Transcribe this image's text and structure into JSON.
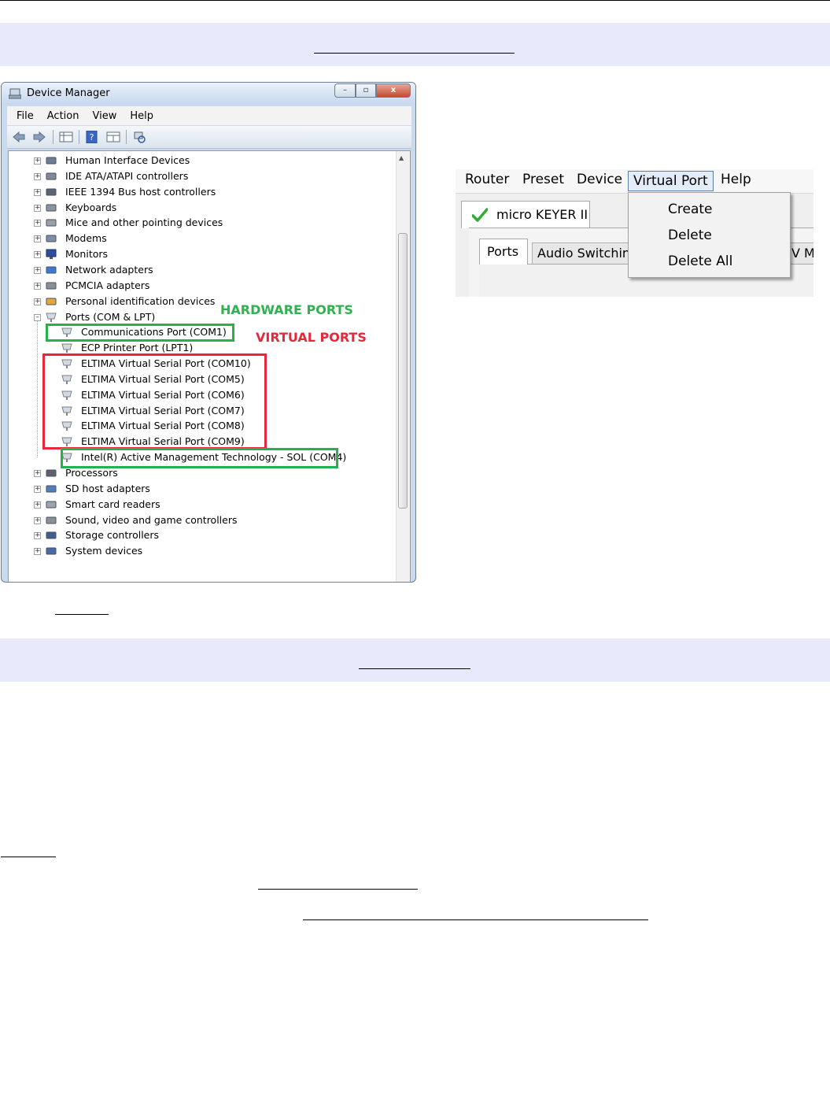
{
  "device_manager": {
    "title": "Device Manager",
    "menu": [
      "File",
      "Action",
      "View",
      "Help"
    ],
    "window_buttons": {
      "minimize": "–",
      "maximize": "▫",
      "close": "x"
    },
    "tree": [
      {
        "label": "Human Interface Devices",
        "icon": "hid-icon",
        "expander": "+"
      },
      {
        "label": "IDE ATA/ATAPI controllers",
        "icon": "ide-icon",
        "expander": "+"
      },
      {
        "label": "IEEE 1394 Bus host controllers",
        "icon": "ieee1394-icon",
        "expander": "+"
      },
      {
        "label": "Keyboards",
        "icon": "keyboard-icon",
        "expander": "+"
      },
      {
        "label": "Mice and other pointing devices",
        "icon": "mouse-icon",
        "expander": "+"
      },
      {
        "label": "Modems",
        "icon": "modem-icon",
        "expander": "+"
      },
      {
        "label": "Monitors",
        "icon": "monitor-icon",
        "expander": "+"
      },
      {
        "label": "Network adapters",
        "icon": "network-icon",
        "expander": "+"
      },
      {
        "label": "PCMCIA adapters",
        "icon": "pcmcia-icon",
        "expander": "+"
      },
      {
        "label": "Personal identification devices",
        "icon": "identification-icon",
        "expander": "+"
      },
      {
        "label": "Ports (COM & LPT)",
        "icon": "port-icon",
        "expander": "–"
      },
      {
        "label": "Communications Port (COM1)",
        "icon": "port-icon",
        "child": true
      },
      {
        "label": "ECP Printer Port (LPT1)",
        "icon": "port-icon",
        "child": true
      },
      {
        "label": "ELTIMA Virtual Serial Port (COM10)",
        "icon": "port-icon",
        "child": true
      },
      {
        "label": "ELTIMA Virtual Serial Port (COM5)",
        "icon": "port-icon",
        "child": true
      },
      {
        "label": "ELTIMA Virtual Serial Port (COM6)",
        "icon": "port-icon",
        "child": true
      },
      {
        "label": "ELTIMA Virtual Serial Port (COM7)",
        "icon": "port-icon",
        "child": true
      },
      {
        "label": "ELTIMA Virtual Serial Port (COM8)",
        "icon": "port-icon",
        "child": true
      },
      {
        "label": "ELTIMA Virtual Serial Port (COM9)",
        "icon": "port-icon",
        "child": true
      },
      {
        "label": "Intel(R) Active Management Technology - SOL (COM4)",
        "icon": "port-icon",
        "child": true
      },
      {
        "label": "Processors",
        "icon": "processor-icon",
        "expander": "+"
      },
      {
        "label": "SD host adapters",
        "icon": "sd-icon",
        "expander": "+"
      },
      {
        "label": "Smart card readers",
        "icon": "smartcard-icon",
        "expander": "+"
      },
      {
        "label": "Sound, video and game controllers",
        "icon": "speaker-icon",
        "expander": "+"
      },
      {
        "label": "Storage controllers",
        "icon": "storage-icon",
        "expander": "+"
      },
      {
        "label": "System devices",
        "icon": "system-icon",
        "expander": "+"
      }
    ],
    "annotations": {
      "hardware": "HARDWARE PORTS",
      "virtual": "VIRTUAL PORTS"
    }
  },
  "router": {
    "menu": [
      "Router",
      "Preset",
      "Device",
      "Virtual Port",
      "Help"
    ],
    "device_tab": "micro KEYER II",
    "subtabs": [
      "Ports",
      "Audio Switching",
      "V Mo"
    ],
    "dropdown": [
      "Create",
      "Delete",
      "Delete All"
    ]
  },
  "colors": {
    "section_band": "#e8e9fb",
    "hardware_box": "#28b04c",
    "virtual_box": "#e6283a",
    "check": "#2fae2f"
  }
}
